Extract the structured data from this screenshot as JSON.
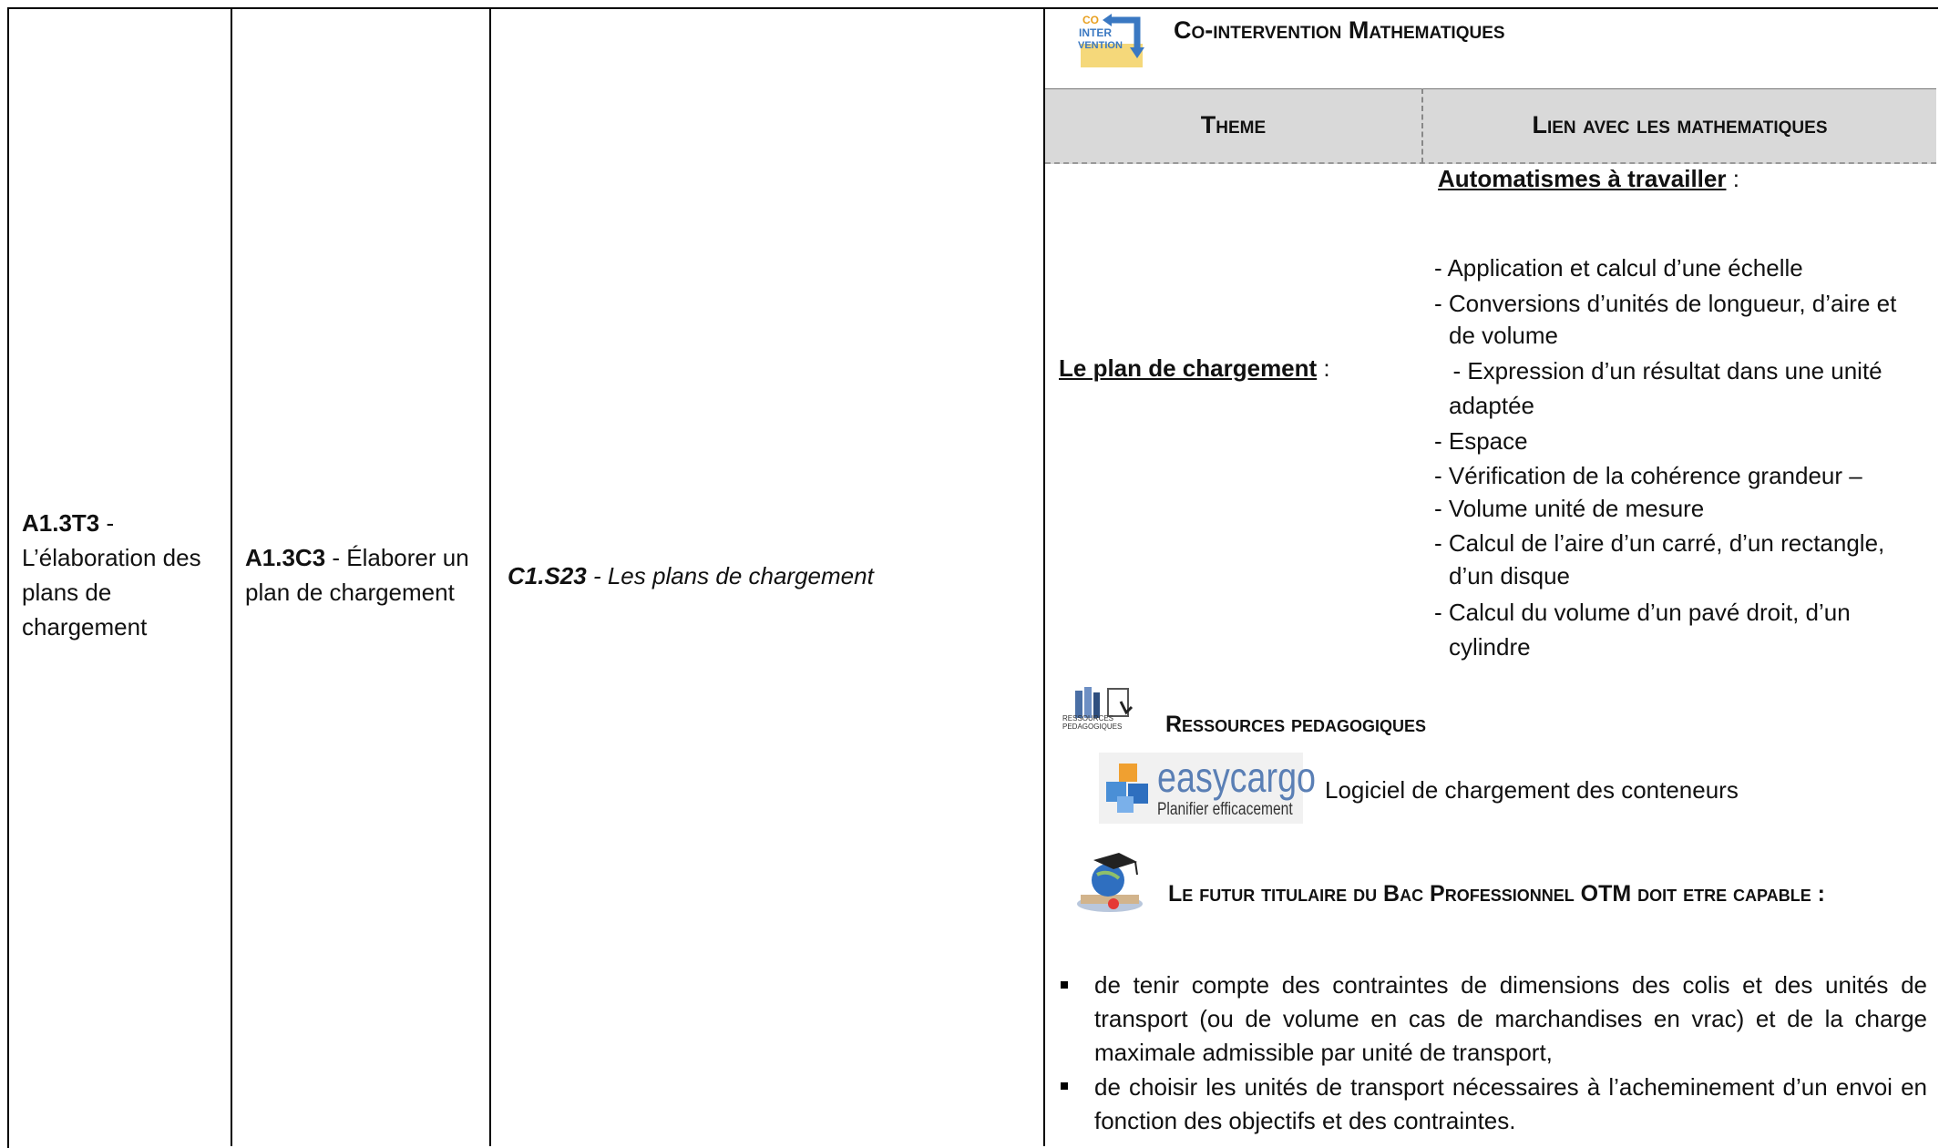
{
  "col1": {
    "code": "A1.3T3",
    "sep": " -",
    "lines": [
      "L’élaboration des",
      "plans de",
      "chargement"
    ]
  },
  "col2": {
    "code": "A1.3C3",
    "sep": " - Élaborer un",
    "line2": "plan de chargement"
  },
  "col3": {
    "code": "C1.S23",
    "rest": " - Les plans de chargement"
  },
  "logo_co": {
    "l1": "CO",
    "l2": "INTER",
    "l3": "VENTION"
  },
  "title": "Co-intervention Mathematiques",
  "table_header": {
    "theme": "Theme",
    "lien": "Lien avec les mathematiques"
  },
  "theme_label": "Le plan de chargement",
  "theme_colon": " :",
  "automatismes_label": "Automatismes à travailler",
  "automatismes_colon": " :",
  "automatismes": [
    "- Application et calcul d’une échelle",
    "- Conversions d’unités de longueur, d’aire et",
    "de volume",
    "- Expression d’un résultat dans une unité",
    "adaptée",
    "- Espace",
    "- Vérification de la cohérence grandeur –",
    "- Volume unité de mesure",
    "- Calcul de l’aire d’un carré, d’un rectangle,",
    "d’un disque",
    "- Calcul du volume d’un pavé droit, d’un",
    "cylindre"
  ],
  "ressources": {
    "icon_caption_1": "RESSOURCES",
    "icon_caption_2": "PEDAGOGIQUES",
    "title": "Ressources pedagogiques",
    "easycargo_name": "easycargo",
    "easycargo_tag": "Planifier efficacement",
    "easycargo_desc": "Logiciel de chargement des conteneurs"
  },
  "futur": {
    "title": "Le futur titulaire du Bac Professionnel OTM doit etre capable :"
  },
  "capabilities": [
    "de tenir compte des contraintes de dimensions des colis et des unités de transport (ou de volume en cas de marchandises en vrac) et de la charge maximale admissible par unité de transport,",
    "de choisir les unités de transport nécessaires à l’acheminement d’un envoi en fonction des objectifs et des contraintes."
  ],
  "colors": {
    "header_bg": "#d9d9d9",
    "logo_blue": "#3a78c2",
    "logo_yellow": "#f5d87a",
    "easy_blue": "#4a8fd6",
    "easy_orange": "#f0a030"
  }
}
